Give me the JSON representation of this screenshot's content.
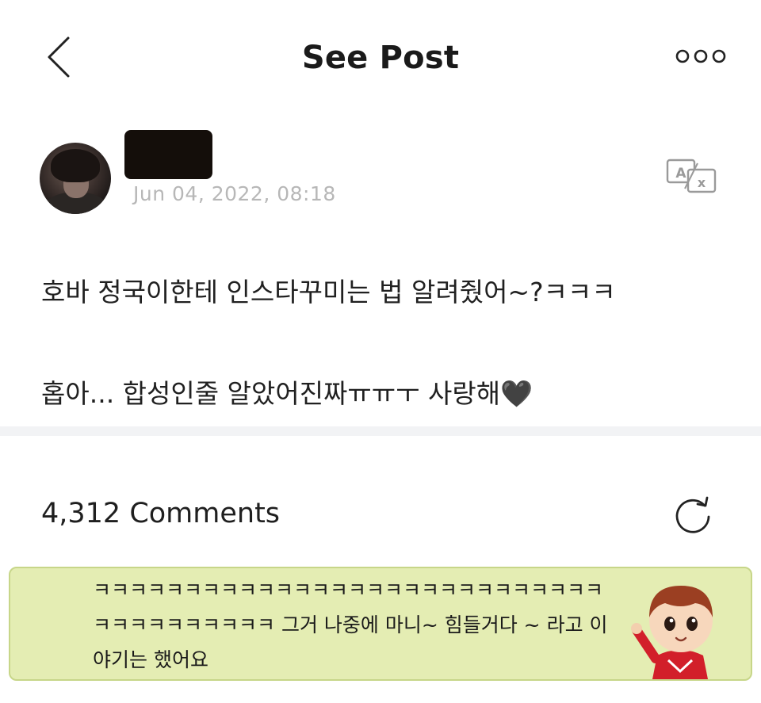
{
  "header": {
    "title": "See Post",
    "back_icon": "chevron-left-icon",
    "more_icon": "more-dots-icon"
  },
  "author": {
    "avatar_icon": "avatar",
    "name_redacted": true,
    "timestamp": "Jun 04, 2022, 08:18",
    "translate_icon": "translate-icon"
  },
  "post": {
    "line1": "호바 정국이한테 인스타꾸미는 법 알려줬어~?ㅋㅋㅋ",
    "line2": "홉아... 합성인줄 알았어진짜ㅠㅠㅜ 사랑해🖤"
  },
  "comments": {
    "count_label": "4,312 Comments",
    "refresh_icon": "refresh-icon",
    "items": [
      {
        "text": "ㅋㅋㅋㅋㅋㅋㅋㅋㅋㅋㅋㅋㅋㅋㅋㅋㅋㅋㅋㅋㅋㅋㅋㅋㅋㅋㅋㅋㅋㅋㅋㅋㅋㅋㅋㅋㅋㅋ 그거 나중에 마니~ 힘들거다 ~ 라고 이야기는 했어요",
        "sticker_icon": "character-sticker-icon",
        "background": "#e4edb3"
      }
    ]
  },
  "colors": {
    "divider": "#f2f3f5",
    "timestamp": "#b7b7b7",
    "card_border": "#c7d689"
  }
}
